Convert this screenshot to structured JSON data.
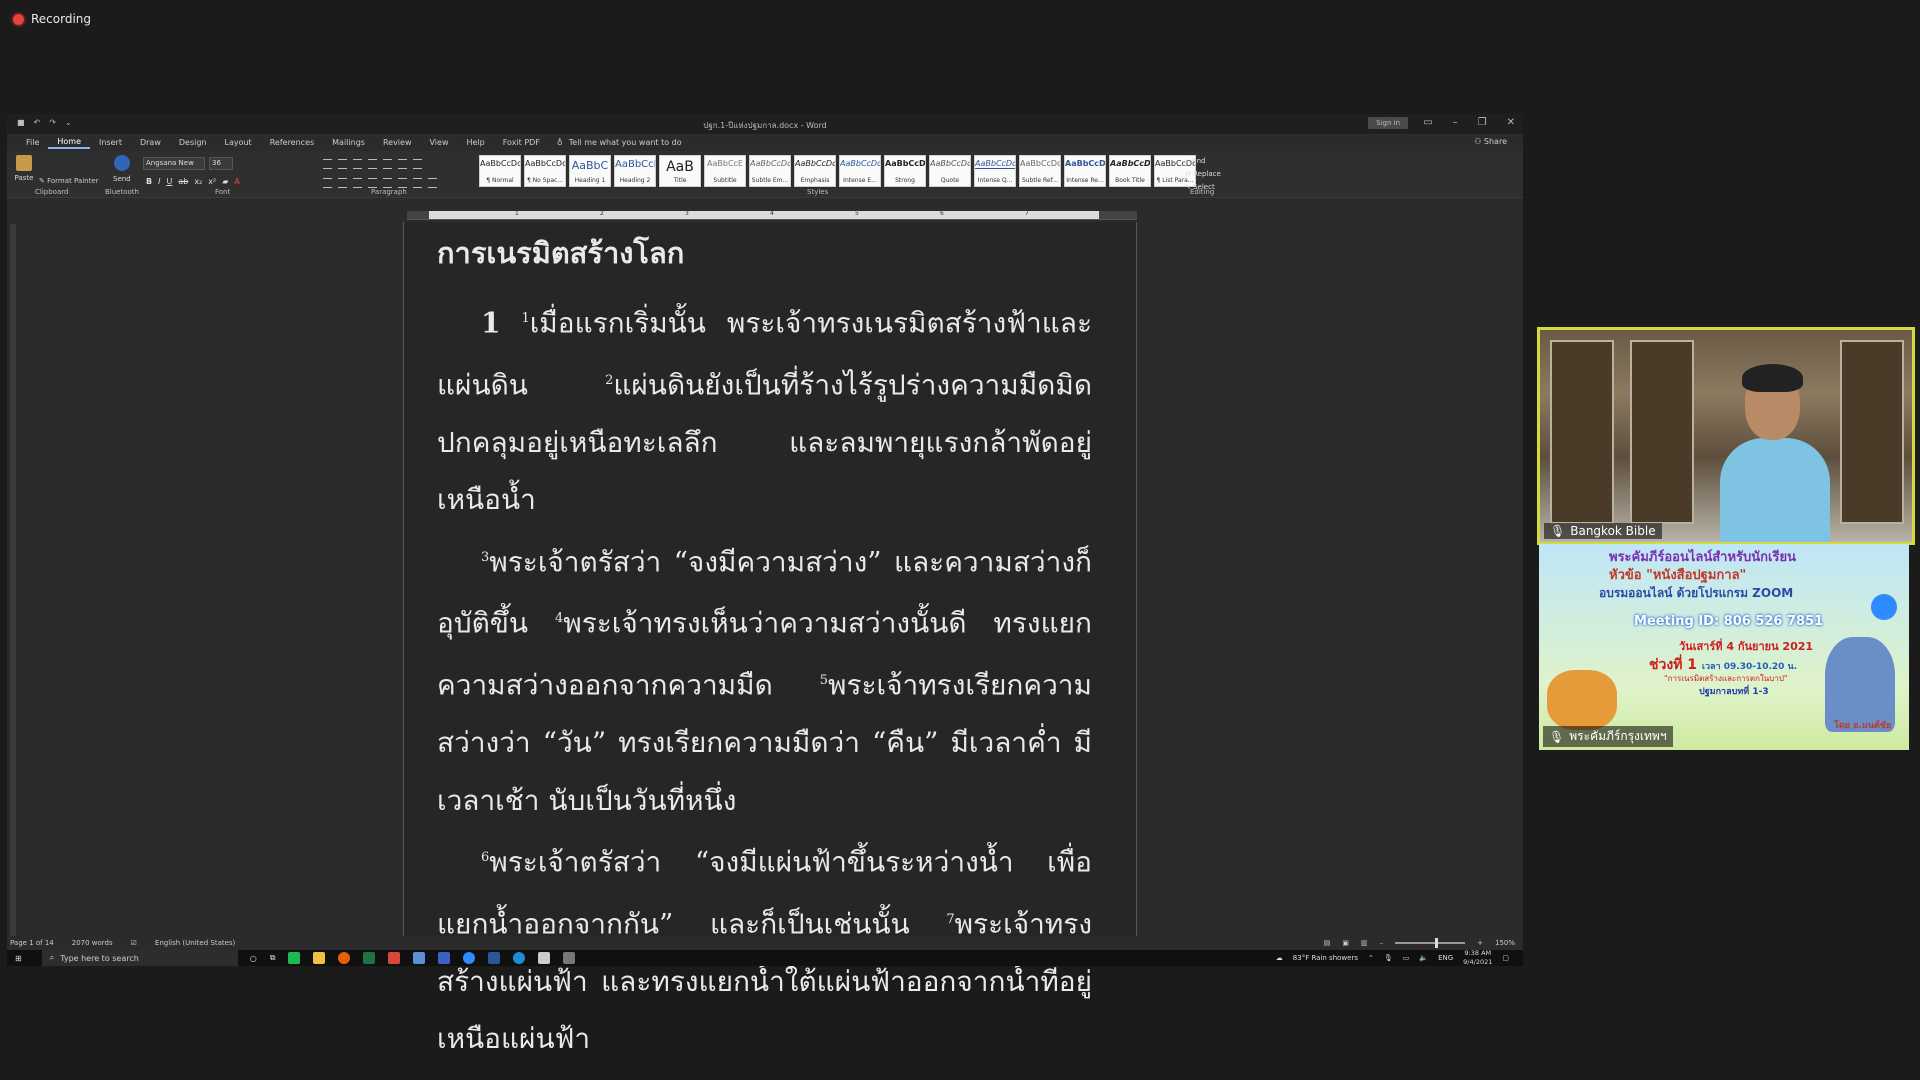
{
  "recording": {
    "label": "Recording"
  },
  "word": {
    "title": "ปฐก.1-ปีแห่งปฐมกาล.docx - Word",
    "sign_in": "Sign in",
    "share": "Share",
    "menu_tabs": [
      "File",
      "Home",
      "Insert",
      "Draw",
      "Design",
      "Layout",
      "References",
      "Mailings",
      "Review",
      "View",
      "Help",
      "Foxit PDF"
    ],
    "tell_me": "Tell me what you want to do",
    "ribbon": {
      "paste": "Paste",
      "format_painter": "Format Painter",
      "send": "Send",
      "font_name": "Angsana New",
      "font_size": "36",
      "groups": {
        "clipboard": "Clipboard",
        "bluetooth": "Bluetooth",
        "font": "Font",
        "paragraph": "Paragraph",
        "styles": "Styles",
        "editing": "Editing"
      },
      "styles": [
        {
          "sample": "AaBbCcDc",
          "name": "¶ Normal"
        },
        {
          "sample": "AaBbCcDc",
          "name": "¶ No Spac..."
        },
        {
          "sample": "AaBbC",
          "name": "Heading 1"
        },
        {
          "sample": "AaBbCcI",
          "name": "Heading 2"
        },
        {
          "sample": "AaB",
          "name": "Title"
        },
        {
          "sample": "AaBbCcE",
          "name": "Subtitle"
        },
        {
          "sample": "AaBbCcDc",
          "name": "Subtle Em..."
        },
        {
          "sample": "AaBbCcDc",
          "name": "Emphasis"
        },
        {
          "sample": "AaBbCcDc",
          "name": "Intense E..."
        },
        {
          "sample": "AaBbCcDc",
          "name": "Strong"
        },
        {
          "sample": "AaBbCcDc",
          "name": "Quote"
        },
        {
          "sample": "AaBbCcDc",
          "name": "Intense Q..."
        },
        {
          "sample": "AaBbCcDc",
          "name": "Subtle Ref..."
        },
        {
          "sample": "AaBbCcDc",
          "name": "Intense Re..."
        },
        {
          "sample": "AaBbCcDc",
          "name": "Book Title"
        },
        {
          "sample": "AaBbCcDc",
          "name": "¶ List Para..."
        }
      ],
      "editing": {
        "find": "Find",
        "replace": "Replace",
        "select": "Select"
      }
    },
    "ruler_numbers": [
      "1",
      "2",
      "3",
      "4",
      "5",
      "6",
      "7"
    ],
    "document": {
      "heading": "การเนรมิตสร้างโลก",
      "paragraphs": [
        {
          "chapter": "1",
          "v1": "1",
          "t1": "เมื่อแรกเริ่มนั้น พระเจ้าทรงเนรมิตสร้างฟ้าและแผ่นดิน",
          "v2": "2",
          "t2": "แผ่นดินยังเป็นที่ร้างไร้รูปร่างความมืดมิดปกคลุมอยู่เหนือทะเลลึก และลมพายุแรงกล้าพัดอยู่เหนือน้ำ"
        },
        {
          "v3": "3",
          "t3": "พระเจ้าตรัสว่า “จงมีความสว่าง” และความสว่างก็อุบัติขึ้น",
          "v4": "4",
          "t4": "พระเจ้าทรงเห็นว่าความสว่างนั้นดี ทรงแยกความสว่างออกจากความมืด",
          "v5": "5",
          "t5": "พระเจ้าทรงเรียกความสว่างว่า “วัน” ทรงเรียกความมืดว่า “คืน” มีเวลาค่ำ มีเวลาเช้า นับเป็นวันที่หนึ่ง"
        },
        {
          "v6": "6",
          "t6": "พระเจ้าตรัสว่า “จงมีแผ่นฟ้าขึ้นระหว่างน้ำ เพื่อแยกน้ำออกจากกัน” และก็เป็นเช่นนั้น",
          "v7": "7",
          "t7": "พระเจ้าทรงสร้างแผ่นฟ้า และทรงแยกน้ำใต้แผ่นฟ้าออกจากน้ำที่อยู่เหนือแผ่นฟ้า"
        }
      ]
    },
    "status": {
      "page": "Page 1 of 14",
      "words": "2070 words",
      "language": "English (United States)",
      "zoom": "150%"
    }
  },
  "taskbar": {
    "search_placeholder": "Type here to search",
    "weather": "83°F  Rain showers",
    "lang": "ENG",
    "time": "9:38 AM",
    "date": "9/4/2021"
  },
  "video": {
    "participant_name": "Bangkok Bible",
    "banner": {
      "line1": "พระคัมภีร์ออนไลน์สำหรับนักเรียน",
      "line2": "หัวข้อ \"หนังสือปฐมกาล\"",
      "line3": "อบรมออนไลน์ ด้วยโปรแกรม ZOOM",
      "meeting": "Meeting ID:  806 526 7851",
      "date": "วันเสาร์ที่ 4 กันยายน 2021",
      "session": "ช่วงที่ 1",
      "session_time": "เวลา 09.30-10.20 น.",
      "topic": "\"การเนรมิตสร้างและการตกในบาป\"",
      "chapter": "ปฐมกาลบทที่ 1-3",
      "by": "โดย อ.มนต์ชัย"
    },
    "banner_name": "พระคัมภีร์กรุงเทพฯ"
  }
}
